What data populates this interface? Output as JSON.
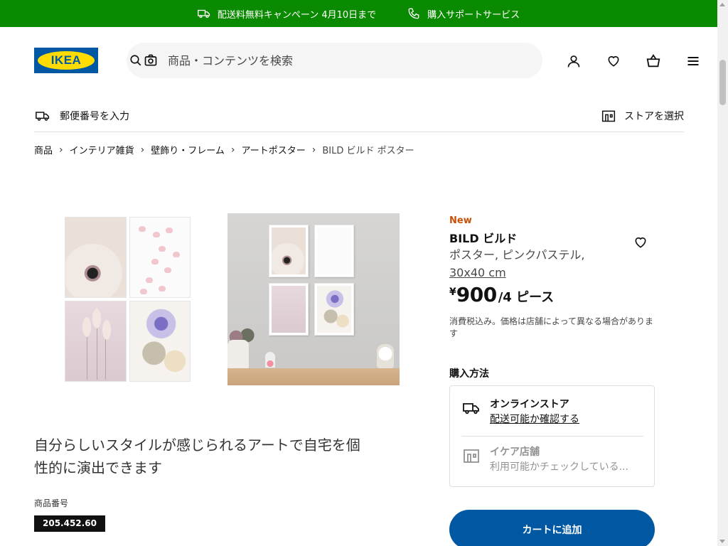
{
  "banner": {
    "left_text": "配送料無料キャンペーン 4月10日まで",
    "right_text": "購入サポートサービス",
    "color": "#0a8a00"
  },
  "logo": {
    "text": "IKEA",
    "bg": "#0058a3",
    "fg": "#ffdb00"
  },
  "search": {
    "placeholder": "商品・コンテンツを検索"
  },
  "header_icons": [
    "user-icon",
    "heart-icon",
    "cart-icon",
    "menu-icon"
  ],
  "subbar": {
    "postal": "郵便番号を入力",
    "store": "ストアを選択"
  },
  "breadcrumb": [
    "商品",
    "インテリア雑貨",
    "壁飾り・フレーム",
    "アートポスター",
    "BILD ビルド ポスター"
  ],
  "product": {
    "new_label": "New",
    "name": "BILD ビルド",
    "desc_line": "ポスター, ピンクパステル,",
    "size": "30x40 cm",
    "currency": "¥",
    "price": "900",
    "unit": "/4 ピース",
    "tax_note": "消費税込み。価格は店舗によって異なる場合があります",
    "how_to_buy": "購入方法",
    "online_title": "オンラインストア",
    "online_link": "配送可能か確認する",
    "store_title": "イケア店舗",
    "store_status": "利用可能かチェックしている...",
    "cart_button": "カートに追加",
    "accent_new": "#ca5008",
    "accent_button": "#0058a3"
  },
  "headline": "自分らしいスタイルが感じられるアートで自宅を個性的に演出できます",
  "article": {
    "label": "商品番号",
    "number": "205.452.60"
  }
}
